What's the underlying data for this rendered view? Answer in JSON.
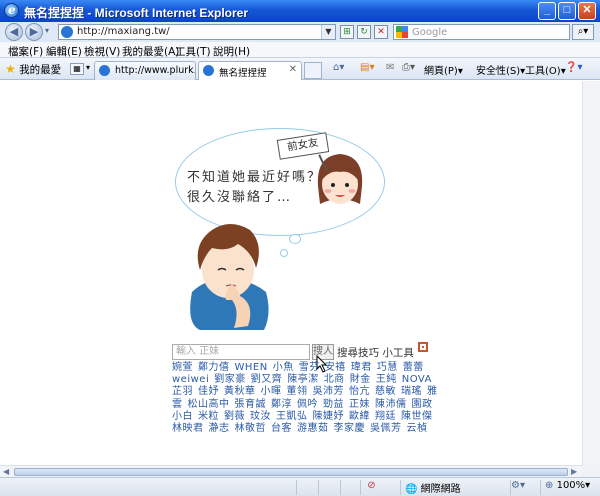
{
  "window": {
    "title": "無名捏捏捏 - Microsoft Internet Explorer"
  },
  "address": {
    "url": "http://maxiang.tw/",
    "search_placeholder": "Google"
  },
  "menu": [
    "檔案(F)",
    "編輯(E)",
    "檢視(V)",
    "我的最愛(A)",
    "工具(T)",
    "說明(H)"
  ],
  "favorites_label": "我的最愛",
  "tabs": [
    {
      "label": "http://www.plurk.com/ta..."
    },
    {
      "label": "無名捏捏捏"
    }
  ],
  "toolbar": {
    "page": "網頁(P)",
    "safety": "安全性(S)",
    "tools": "工具(O)"
  },
  "sign_text": "前女友",
  "bubble_lines": [
    "不知道她最近好嗎？",
    "很久沒聯絡了…"
  ],
  "search": {
    "placeholder": "輸入 正妹",
    "button": "搜人",
    "tools_text": "搜尋技巧  小工具"
  },
  "names": [
    "婉萱",
    "鄭力僖",
    "WHEN",
    "小魚",
    "雪芬",
    "安禧",
    "瑋君",
    "巧慧",
    "蕾蕾",
    "weiwei",
    "劉家豪",
    "劉又齊",
    "陳亭潔",
    "北商",
    "財金",
    "王純",
    "NOVA",
    "芷羽",
    "佳妤",
    "黃秋華",
    "小暉",
    "董翎",
    "吳沛芳",
    "怡亢",
    "慈敏",
    "瑞瑤",
    "雅雲",
    "松山高中",
    "張育誠",
    "鄭淳",
    "佩吟",
    "勁益",
    "正妹",
    "陳沛儒",
    "園政",
    "小白",
    "米粒",
    "劉薇",
    "玟汝",
    "王凱弘",
    "陳婕妤",
    "歐緯",
    "翔廷",
    "陳世傑",
    "林映君",
    "瀞志",
    "林敬哲",
    "台客",
    "游惠茹",
    "李家慶",
    "吳佩芳",
    "云楨"
  ],
  "status": {
    "zone": "網際網路",
    "zoom": "100%"
  }
}
